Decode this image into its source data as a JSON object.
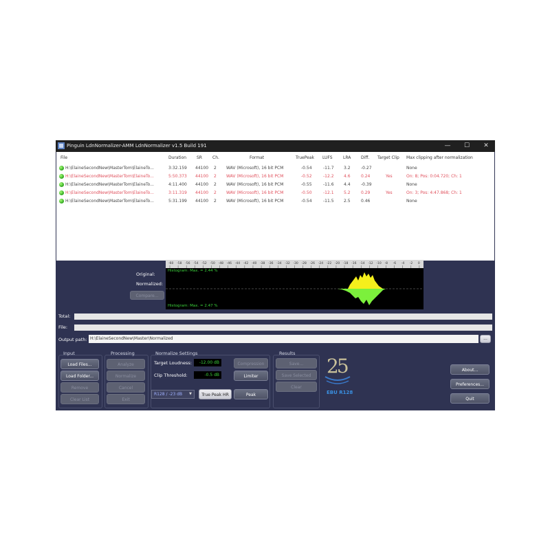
{
  "window": {
    "title": "Pinguin LdnNormalizer-AMM LdnNormalizer v1.5 Build 191",
    "controls": {
      "minimize": "—",
      "maximize": "☐",
      "close": "✕"
    }
  },
  "columns": [
    "File",
    "Duration",
    "SR",
    "Ch.",
    "Format",
    "TruePeak",
    "LUFS",
    "LRA",
    "Diff.",
    "Target Clip",
    "Max clipping after normalization"
  ],
  "files": [
    {
      "file": "H:\\ElaineSecondNew\\MasterTom\\ElaineTo...",
      "duration": "3:32.159",
      "sr": "44100",
      "ch": "2",
      "format": "WAV (Microsoft),  16 bit PCM",
      "truepeak": "-0.54",
      "lufs": "-11.7",
      "lra": "3.2",
      "diff": "-0.27",
      "target_clip": "",
      "max_clip": "None",
      "warn": false
    },
    {
      "file": "H:\\ElaineSecondNew\\MasterTom\\ElaineTo...",
      "duration": "5:50.373",
      "sr": "44100",
      "ch": "2",
      "format": "WAV (Microsoft),  16 bit PCM",
      "truepeak": "-0.52",
      "lufs": "-12.2",
      "lra": "4.6",
      "diff": "0.24",
      "target_clip": "Yes",
      "max_clip": "On: 8; Pos: 0:04.720; Ch: 1",
      "warn": true
    },
    {
      "file": "H:\\ElaineSecondNew\\MasterTom\\ElaineTo...",
      "duration": "4:11.400",
      "sr": "44100",
      "ch": "2",
      "format": "WAV (Microsoft),  16 bit PCM",
      "truepeak": "-0.55",
      "lufs": "-11.6",
      "lra": "4.4",
      "diff": "-0.39",
      "target_clip": "",
      "max_clip": "None",
      "warn": false
    },
    {
      "file": "H:\\ElaineSecondNew\\MasterTom\\ElaineTo...",
      "duration": "3:11.319",
      "sr": "44100",
      "ch": "2",
      "format": "WAV (Microsoft),  16 bit PCM",
      "truepeak": "-0.50",
      "lufs": "-12.1",
      "lra": "5.2",
      "diff": "0.29",
      "target_clip": "Yes",
      "max_clip": "On: 3; Pos: 4:47.868; Ch: 1",
      "warn": true
    },
    {
      "file": "H:\\ElaineSecondNew\\MasterTom\\ElaineTo...",
      "duration": "5:31.199",
      "sr": "44100",
      "ch": "2",
      "format": "WAV (Microsoft),  16 bit PCM",
      "truepeak": "-0.54",
      "lufs": "-11.5",
      "lra": "2.5",
      "diff": "0.46",
      "target_clip": "",
      "max_clip": "None",
      "warn": false
    }
  ],
  "ruler_ticks": [
    "-60",
    "-58",
    "-56",
    "-54",
    "-52",
    "-50",
    "-48",
    "-46",
    "-44",
    "-42",
    "-40",
    "-38",
    "-36",
    "-34",
    "-32",
    "-30",
    "-28",
    "-26",
    "-24",
    "-22",
    "-20",
    "-18",
    "-16",
    "-14",
    "-12",
    "-10",
    "-8",
    "-6",
    "-4",
    "-2",
    "0"
  ],
  "meters": {
    "original_label": "Original:",
    "normalized_label": "Normalized:",
    "compare_button": "Compare...",
    "histo_top": "Histogram: Max. = 2.44 %",
    "histo_bottom": "Histogram: Max. = 2.47 %"
  },
  "progress": {
    "total_label": "Total:",
    "file_label": "File:"
  },
  "output": {
    "label": "Output path:",
    "value": "H:\\ElaineSecondNew\\Master\\Normalized",
    "browse": "..."
  },
  "groups": {
    "input": "Input",
    "processing": "Processing",
    "normalize": "Normalize Settings",
    "results": "Results"
  },
  "input_buttons": [
    "Load Files...",
    "Load Folder...",
    "Remove",
    "Clear List"
  ],
  "processing_buttons": [
    "Analyze",
    "Normalize",
    "Cancel",
    "Exit"
  ],
  "normalize": {
    "target_label": "Target Loudness:",
    "target_value": "-12.00 dB",
    "clip_label": "Clip Threshold:",
    "clip_value": "-0.5 dB",
    "preset": "R128 / -23 dB",
    "truepeak_button": "True Peak HR",
    "peak_button": "Peak",
    "side_button": "Compression",
    "limiter_button": "Limiter"
  },
  "results_buttons": [
    "Save...",
    "Save Selected",
    "Clear"
  ],
  "logo": {
    "text": "EBU R128",
    "numerals": "25"
  },
  "side_buttons": [
    "About...",
    "Preferences...",
    "Quit"
  ],
  "colors": {
    "window_bg": "#2f3352",
    "titlebar": "#202020",
    "warn_text": "#e0505c",
    "wave_yellow": "#f5ef1c",
    "wave_green": "#7cf03c",
    "logo_blue": "#3a78c8"
  }
}
